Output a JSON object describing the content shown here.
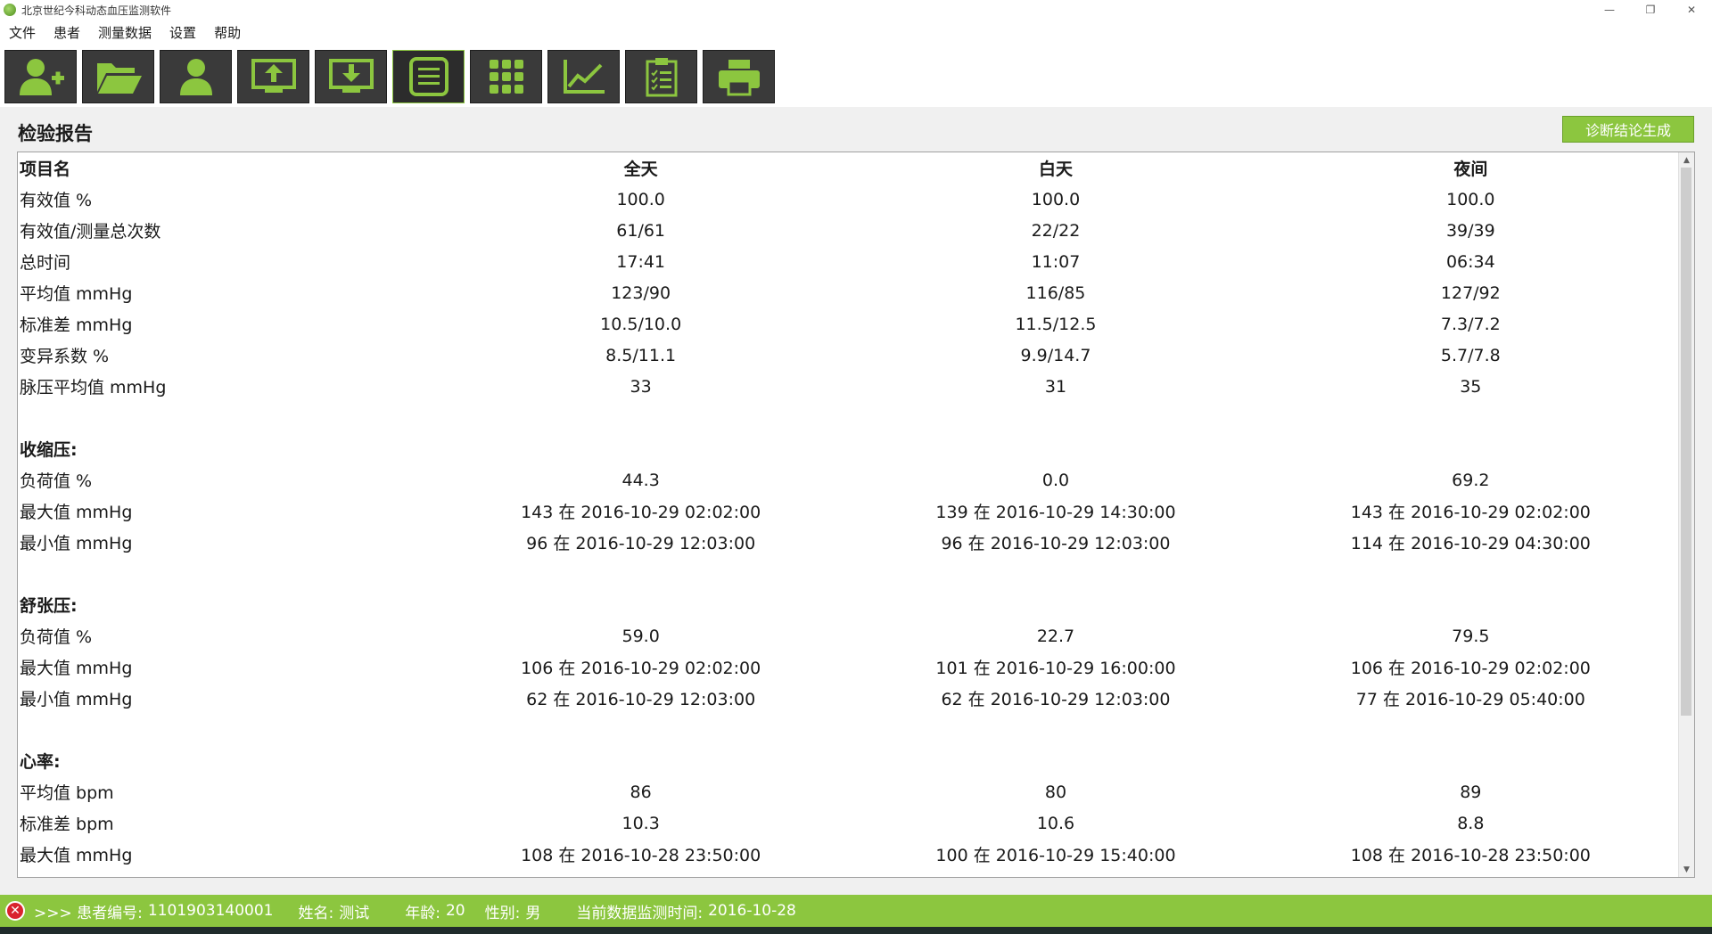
{
  "window": {
    "title": "北京世纪今科动态血压监测软件",
    "controls": [
      "—",
      "❐",
      "✕"
    ]
  },
  "menu": [
    "文件",
    "患者",
    "测量数据",
    "设置",
    "帮助"
  ],
  "toolbar": [
    {
      "icon": "add-patient-icon"
    },
    {
      "icon": "open-folder-icon"
    },
    {
      "icon": "patient-icon"
    },
    {
      "icon": "upload-icon"
    },
    {
      "icon": "download-icon"
    },
    {
      "icon": "list-icon",
      "active": true
    },
    {
      "icon": "grid-icon"
    },
    {
      "icon": "line-chart-icon"
    },
    {
      "icon": "clipboard-icon"
    },
    {
      "icon": "print-icon"
    }
  ],
  "report": {
    "title": "检验报告",
    "generate_button": "诊断结论生成",
    "columns": [
      "项目名",
      "全天",
      "白天",
      "夜间"
    ],
    "rows": [
      {
        "type": "data",
        "cells": [
          "有效值 %",
          "100.0",
          "100.0",
          "100.0"
        ]
      },
      {
        "type": "data",
        "cells": [
          "有效值/测量总次数",
          "61/61",
          "22/22",
          "39/39"
        ]
      },
      {
        "type": "data",
        "cells": [
          "总时间",
          "17:41",
          "11:07",
          "06:34"
        ]
      },
      {
        "type": "data",
        "cells": [
          "平均值 mmHg",
          "123/90",
          "116/85",
          "127/92"
        ]
      },
      {
        "type": "data",
        "cells": [
          "标准差 mmHg",
          "10.5/10.0",
          "11.5/12.5",
          "7.3/7.2"
        ]
      },
      {
        "type": "data",
        "cells": [
          "变异系数 %",
          "8.5/11.1",
          "9.9/14.7",
          "5.7/7.8"
        ]
      },
      {
        "type": "data",
        "cells": [
          "脉压平均值 mmHg",
          "33",
          "31",
          "35"
        ]
      },
      {
        "type": "blank"
      },
      {
        "type": "section",
        "cells": [
          "收缩压:"
        ]
      },
      {
        "type": "data",
        "cells": [
          "负荷值 %",
          "44.3",
          "0.0",
          "69.2"
        ]
      },
      {
        "type": "data",
        "cells": [
          "最大值 mmHg",
          "143 在 2016-10-29 02:02:00",
          "139 在 2016-10-29 14:30:00",
          "143 在 2016-10-29 02:02:00"
        ]
      },
      {
        "type": "data",
        "cells": [
          "最小值 mmHg",
          "96 在 2016-10-29 12:03:00",
          "96 在 2016-10-29 12:03:00",
          "114 在 2016-10-29 04:30:00"
        ]
      },
      {
        "type": "blank"
      },
      {
        "type": "section",
        "cells": [
          "舒张压:"
        ]
      },
      {
        "type": "data",
        "cells": [
          "负荷值 %",
          "59.0",
          "22.7",
          "79.5"
        ]
      },
      {
        "type": "data",
        "cells": [
          "最大值 mmHg",
          "106 在 2016-10-29 02:02:00",
          "101 在 2016-10-29 16:00:00",
          "106 在 2016-10-29 02:02:00"
        ]
      },
      {
        "type": "data",
        "cells": [
          "最小值 mmHg",
          "62 在 2016-10-29 12:03:00",
          "62 在 2016-10-29 12:03:00",
          "77 在 2016-10-29 05:40:00"
        ]
      },
      {
        "type": "blank"
      },
      {
        "type": "section",
        "cells": [
          "心率:"
        ]
      },
      {
        "type": "data",
        "cells": [
          "平均值 bpm",
          "86",
          "80",
          "89"
        ]
      },
      {
        "type": "data",
        "cells": [
          "标准差 bpm",
          "10.3",
          "10.6",
          "8.8"
        ]
      },
      {
        "type": "data",
        "cells": [
          "最大值 mmHg",
          "108 在 2016-10-28 23:50:00",
          "100 在 2016-10-29 15:40:00",
          "108 在 2016-10-28 23:50:00"
        ]
      }
    ]
  },
  "status": {
    "prefix": ">>> 患者编号:",
    "patient_id": "1101903140001",
    "name_label": "姓名:",
    "name": "测试",
    "age_label": "年龄:",
    "age": "20",
    "gender_label": "性别:",
    "gender": "男",
    "time_label": "当前数据监测时间:",
    "time": "2016-10-28"
  },
  "colors": {
    "accent_green": "#8cc63f",
    "toolbar_dark": "#3a3a3a",
    "status_error_red": "#d9232d"
  }
}
